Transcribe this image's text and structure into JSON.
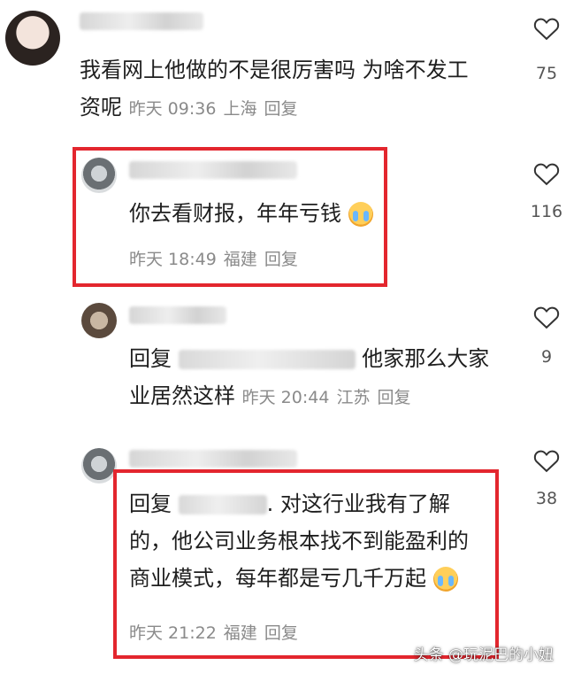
{
  "accent_color": "#e3262e",
  "comments": [
    {
      "text_line1": "我看网上他做的不是很厉害吗 为啥不发工",
      "text_line2": "资呢",
      "time": "昨天 09:36",
      "location": "上海",
      "reply_label": "回复",
      "likes": "75"
    },
    {
      "text": "你去看财报，年年亏钱",
      "emoji_icon": "crying-face-icon",
      "time": "昨天 18:49",
      "location": "福建",
      "reply_label": "回复",
      "likes": "116"
    },
    {
      "text_prefix": "回复",
      "text_line1_after": "他家那么大家",
      "text_line2": "业居然这样",
      "time": "昨天 20:44",
      "location": "江苏",
      "reply_label": "回复",
      "likes": "9"
    },
    {
      "text_prefix": "回复",
      "text_line1_after": ". 对这行业我有了解",
      "text_line2": "的，他公司业务根本找不到能盈利的",
      "text_line3": "商业模式，每年都是亏几千万起",
      "emoji_icon": "crying-face-icon",
      "time": "昨天 21:22",
      "location": "福建",
      "reply_label": "回复",
      "likes": "38"
    }
  ],
  "watermark": "头条 @玩泥巴的小妞"
}
